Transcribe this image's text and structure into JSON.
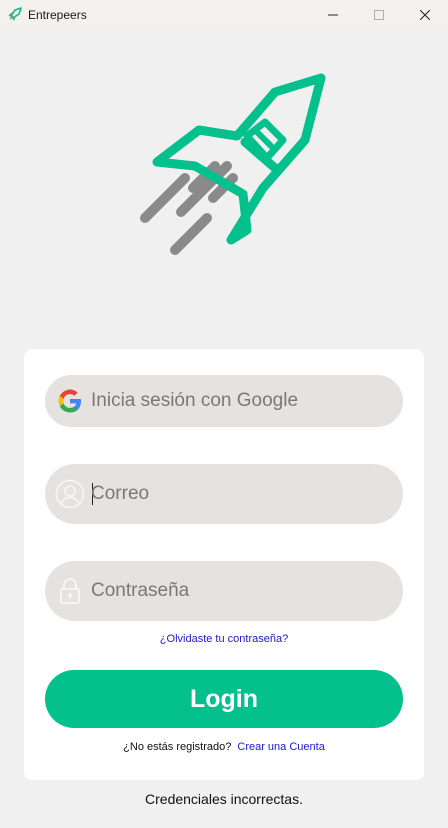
{
  "window": {
    "title": "Entrepeers",
    "icon": "rocket-icon",
    "controls": [
      "minimize-icon",
      "maximize-icon",
      "close-icon"
    ]
  },
  "logo": {
    "icon": "rocket-logo",
    "colors": {
      "body": "#03c08d",
      "speed_lines": "#8a8a8a"
    }
  },
  "login_form": {
    "google_button_label": "Inicia sesión con Google",
    "email": {
      "placeholder": "Correo",
      "value": "",
      "icon": "user-circle-icon"
    },
    "password": {
      "placeholder": "Contraseña",
      "value": "",
      "icon": "lock-icon"
    },
    "forgot_password_link": "¿Olvidaste tu contraseña?",
    "login_button_label": "Login",
    "register_prompt": "¿No estás registrado?",
    "register_link": "Crear una Cuenta"
  },
  "status_message": "Credenciales incorrectas.",
  "colors": {
    "accent": "#03c08d",
    "link": "#1a1ad6",
    "field_bg": "#e6e2df",
    "background": "#f0f0f0"
  }
}
